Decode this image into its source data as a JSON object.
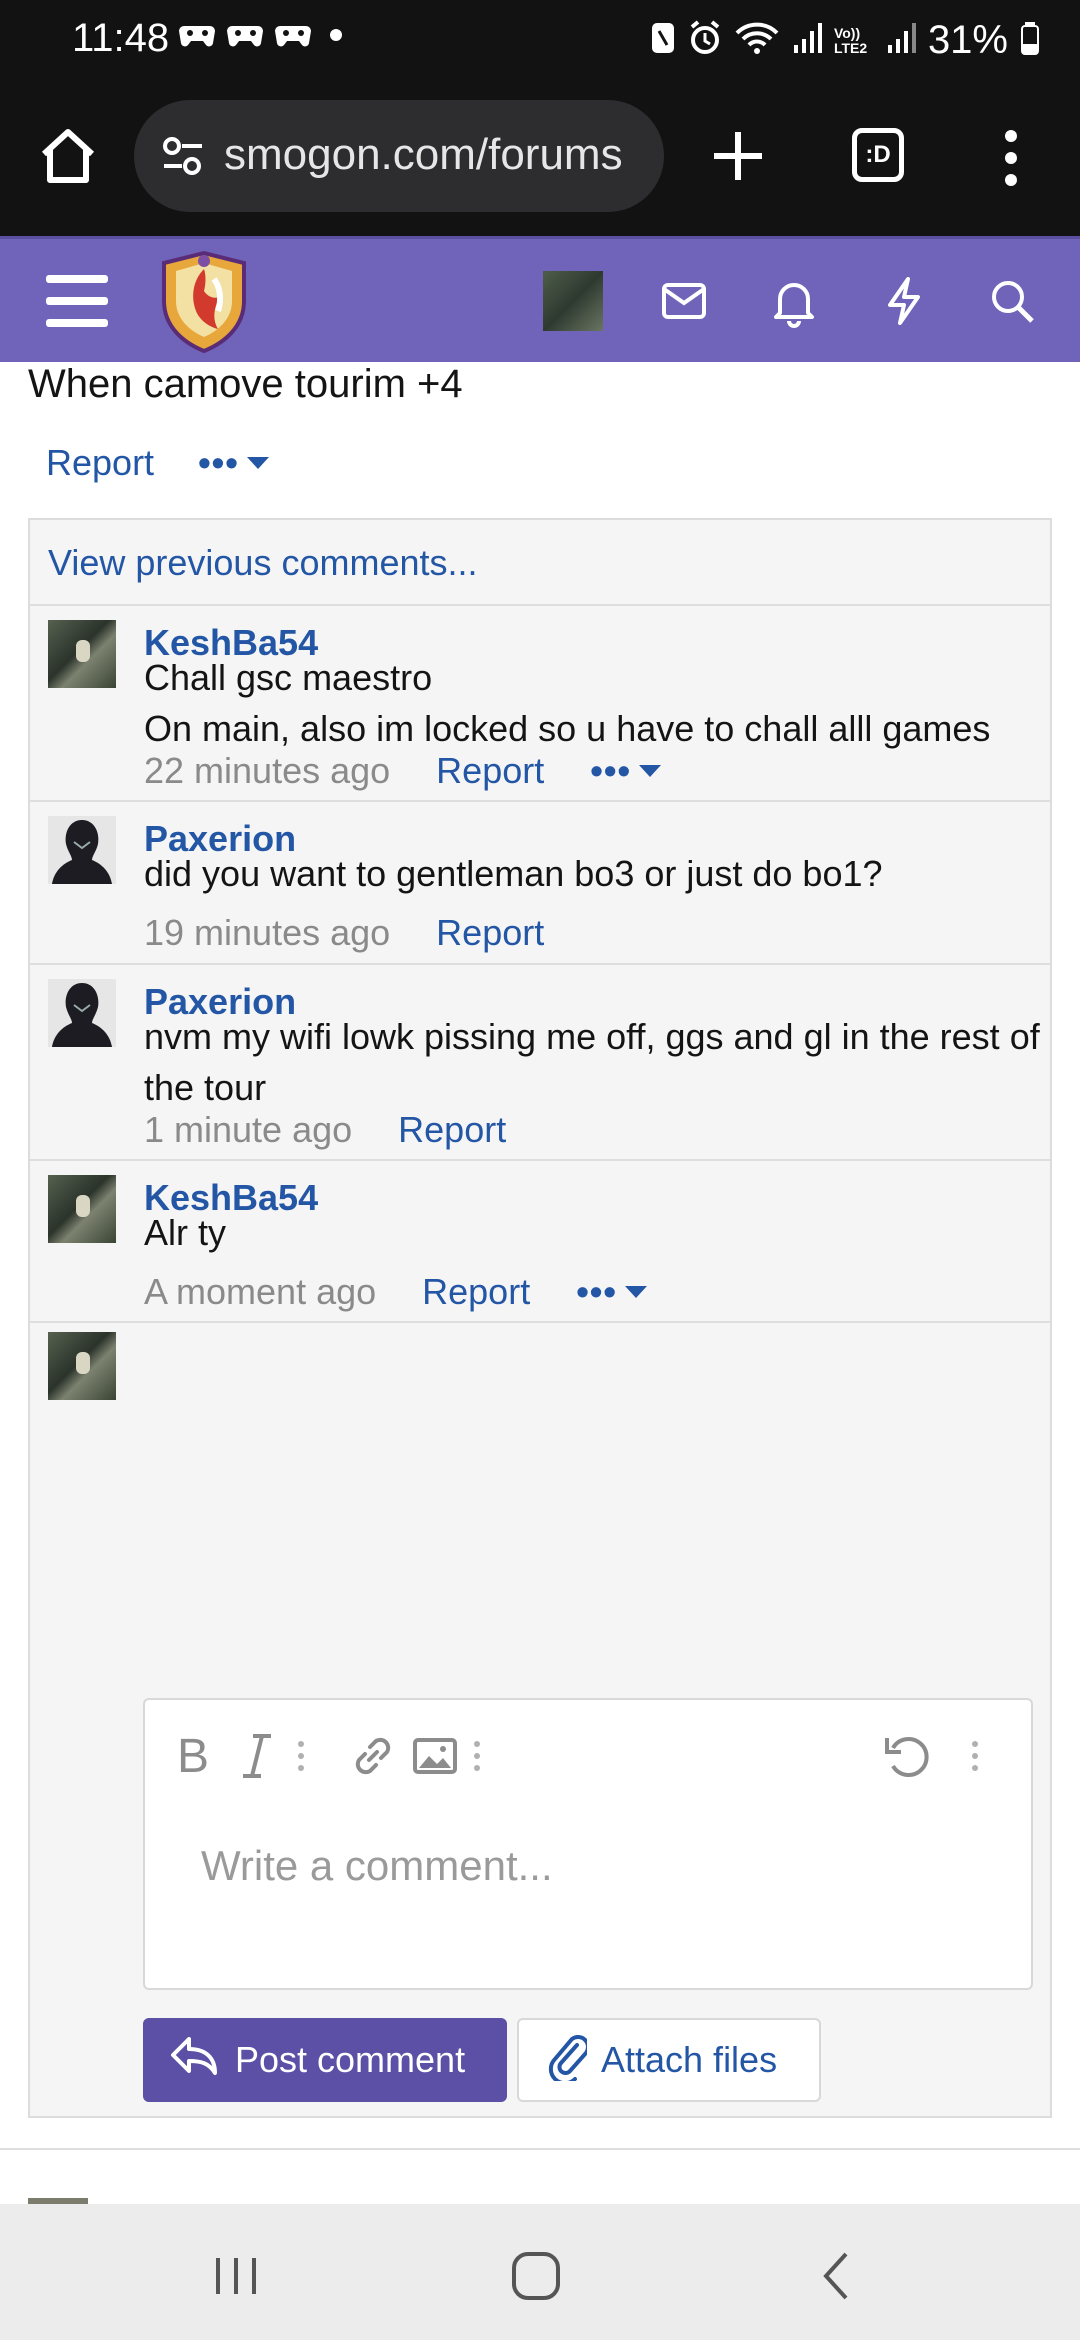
{
  "status_bar": {
    "time": "11:48",
    "battery": "31%",
    "network": "Vo)) LTE2"
  },
  "browser": {
    "url": "smogon.com/forums",
    "tabs_label": ":D"
  },
  "previous_post": {
    "text": "When camove tourim +4",
    "report_label": "Report",
    "more_label": "•••"
  },
  "comments_section": {
    "view_previous": "View previous comments...",
    "comments": [
      {
        "user": "KeshBa54",
        "lines": [
          "Chall gsc maestro",
          "On main, also im locked so u have to chall alll games"
        ],
        "time": "22 minutes ago",
        "report": "Report",
        "more": "•••"
      },
      {
        "user": "Paxerion",
        "lines": [
          "did you want to gentleman bo3 or just do bo1?"
        ],
        "time": "19 minutes ago",
        "report": "Report"
      },
      {
        "user": "Paxerion",
        "lines": [
          "nvm my wifi lowk pissing me off, ggs and gl in the rest of the tour"
        ],
        "time": "1 minute ago",
        "report": "Report"
      },
      {
        "user": "KeshBa54",
        "lines": [
          "Alr ty"
        ],
        "time": "A moment ago",
        "report": "Report",
        "more": "•••"
      }
    ]
  },
  "editor": {
    "placeholder": "Write a comment...",
    "post_button": "Post comment",
    "attach_button": "Attach files"
  },
  "colors": {
    "header_purple": "#6f64b9",
    "link_blue": "#2456a6",
    "button_purple": "#5b4fa6"
  }
}
